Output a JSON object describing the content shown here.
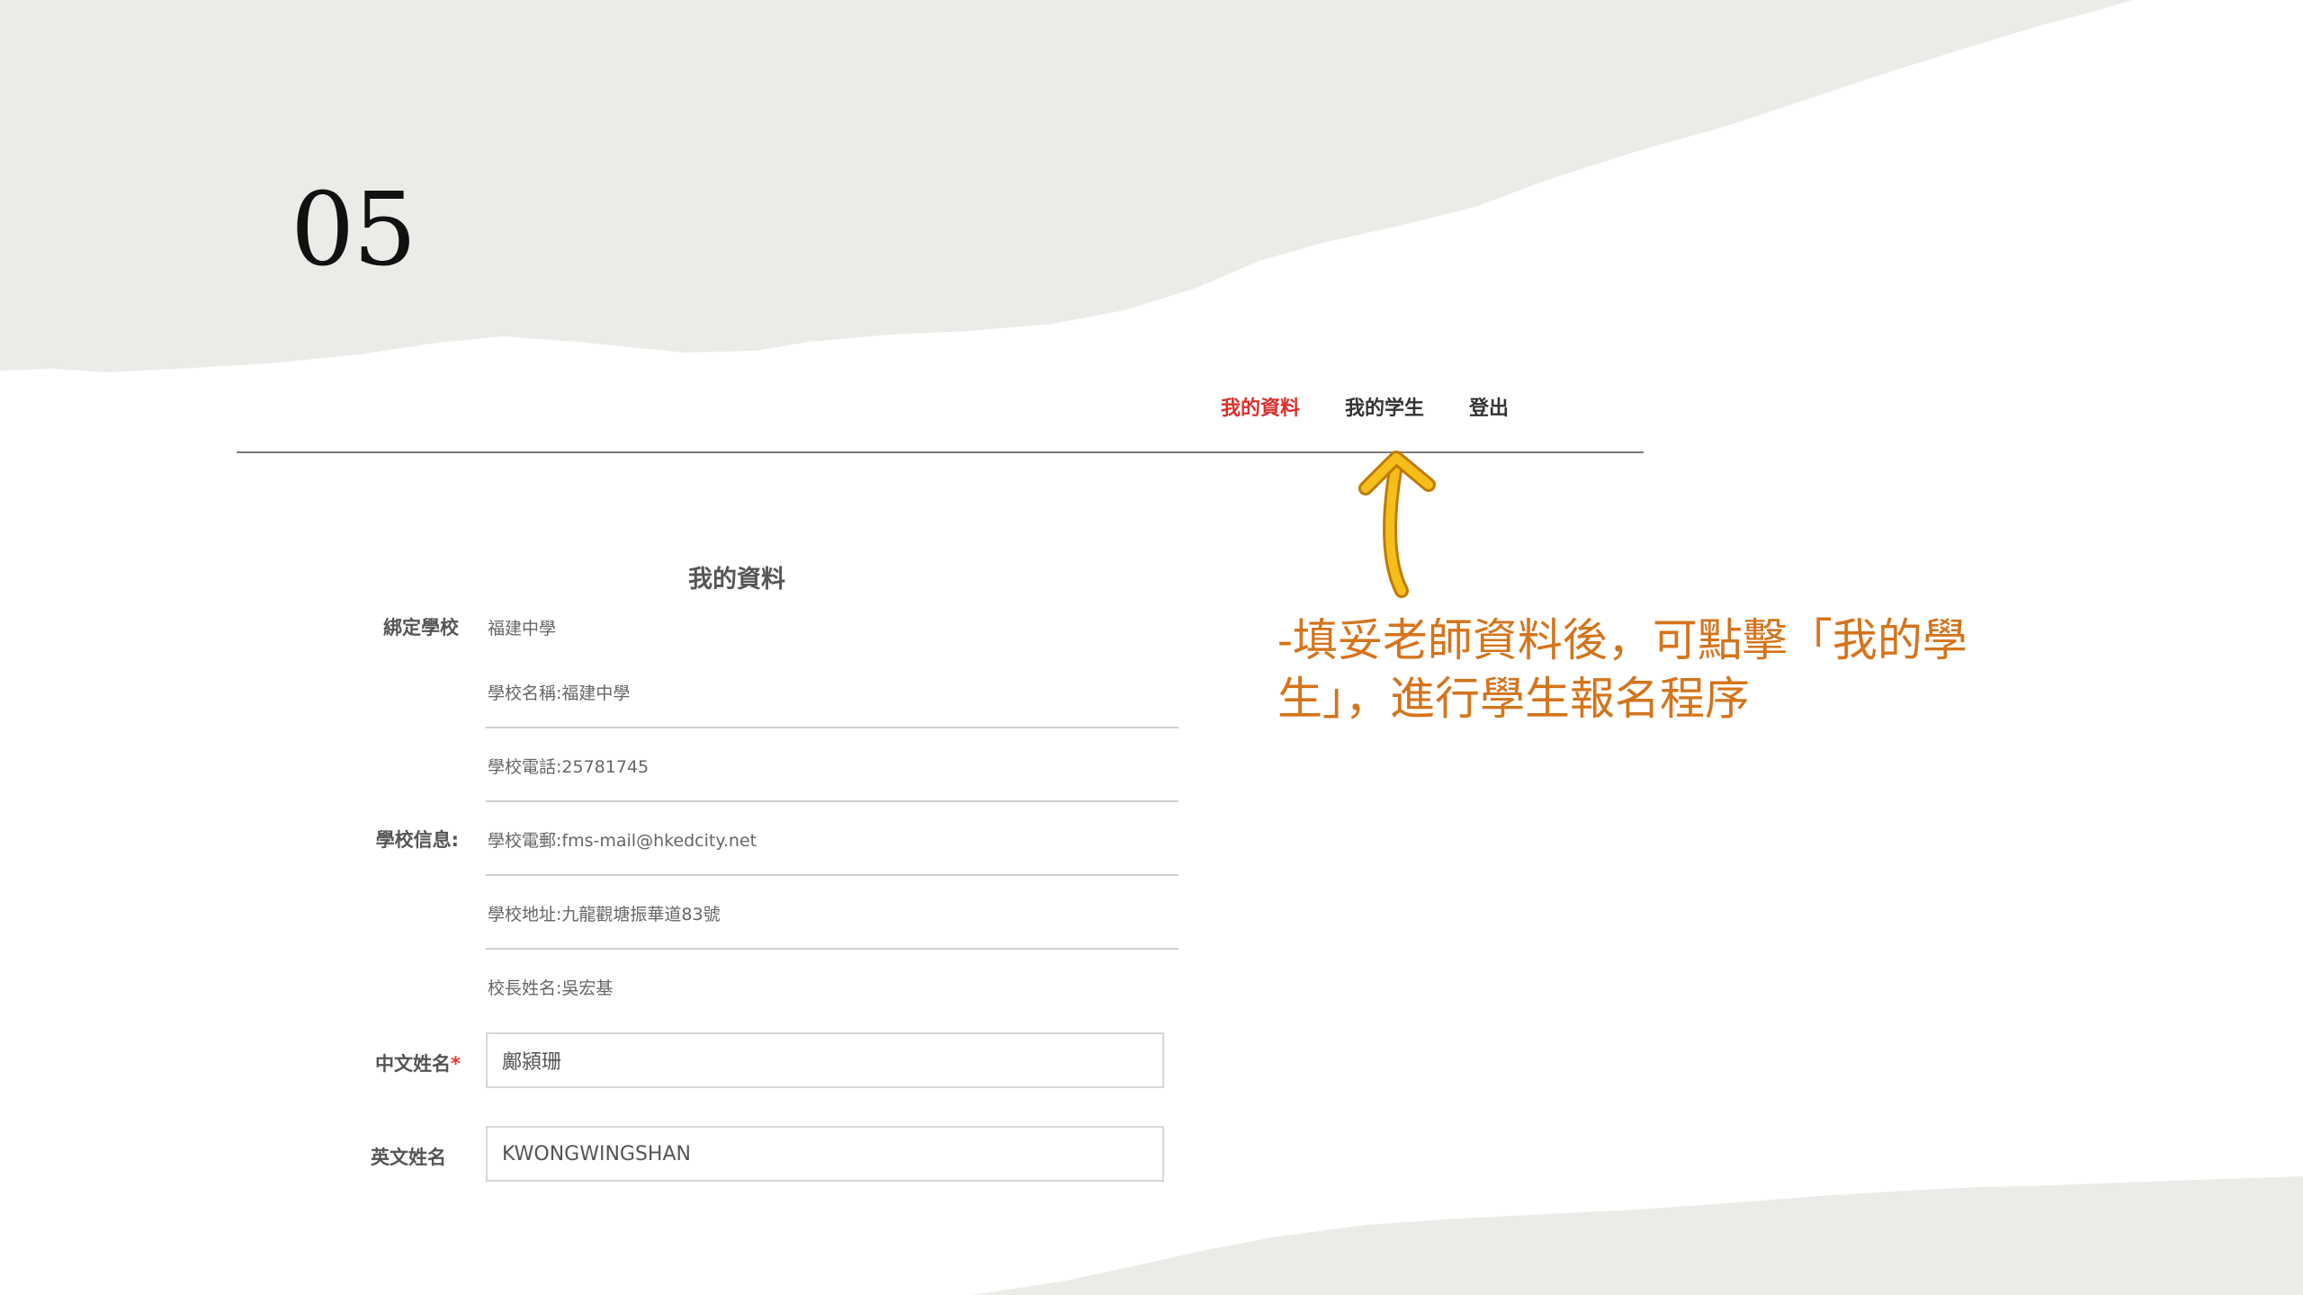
{
  "slide": {
    "number": "05"
  },
  "nav": {
    "items": [
      {
        "label": "我的資料",
        "active": true
      },
      {
        "label": "我的学生",
        "active": false
      },
      {
        "label": "登出",
        "active": false
      }
    ]
  },
  "annotation": {
    "text": "-填妥老師資料後，可點擊「我的學生」，進行學生報名程序",
    "color": "#d4741c",
    "arrow_color": "#f6be1a"
  },
  "form": {
    "title": "我的資料",
    "bound_school": {
      "label": "綁定學校",
      "value": "福建中學"
    },
    "school_info": {
      "label": "學校信息:",
      "lines": [
        "學校名稱:福建中學",
        "學校電話:25781745",
        "學校電郵:fms-mail@hkedcity.net",
        "學校地址:九龍觀塘振華道83號",
        "校長姓名:吳宏基"
      ]
    },
    "chinese_name": {
      "label": "中文姓名",
      "required_mark": "*",
      "value": "鄺潁珊"
    },
    "english_name": {
      "label": "英文姓名",
      "value": "KWONGWINGSHAN"
    }
  },
  "colors": {
    "background_paper": "#ebebe8",
    "active_nav": "#d9312b",
    "accent": "#d4741c"
  }
}
